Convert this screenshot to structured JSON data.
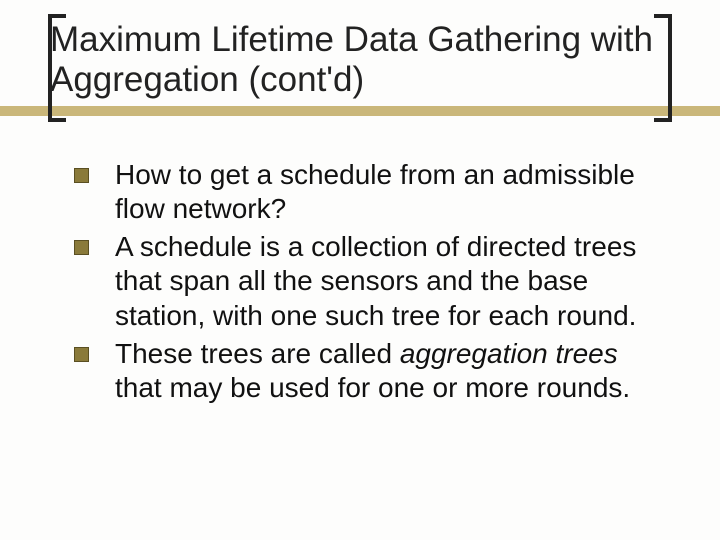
{
  "title": "Maximum Lifetime Data Gathering with Aggregation (cont'd)",
  "bullets": [
    {
      "html": "How to get a schedule from an admissible flow network?"
    },
    {
      "html": "A schedule is a collection of directed trees that span all the sensors and the base station, with one such tree for each round."
    },
    {
      "html": "These trees are called <em>aggregation trees</em> that may be used for one or more rounds."
    }
  ]
}
